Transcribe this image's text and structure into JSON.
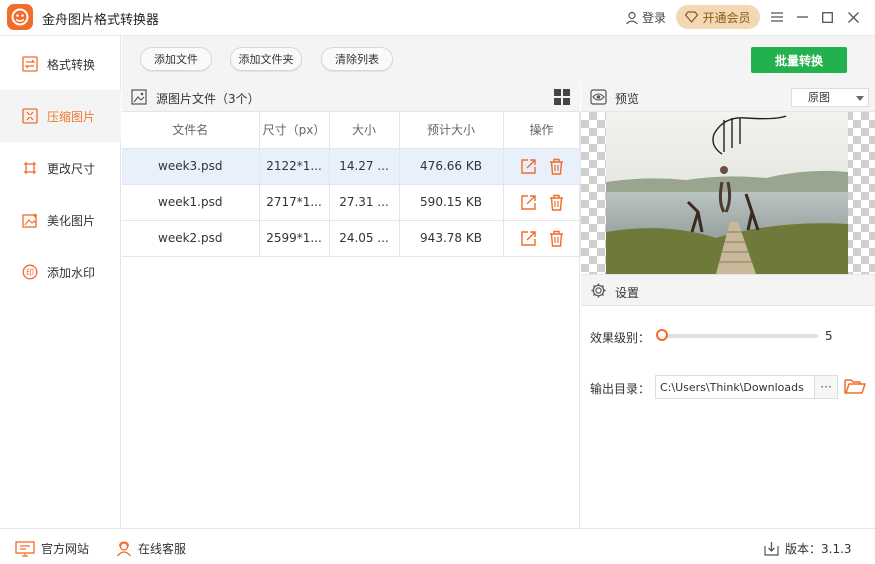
{
  "app": {
    "title": "金舟图片格式转换器"
  },
  "header": {
    "login": "登录",
    "vip": "开通会员"
  },
  "sidebar": {
    "items": [
      {
        "label": "格式转换",
        "icon": "format-convert-icon"
      },
      {
        "label": "压缩图片",
        "icon": "compress-image-icon",
        "active": true
      },
      {
        "label": "更改尺寸",
        "icon": "resize-icon"
      },
      {
        "label": "美化图片",
        "icon": "beautify-icon"
      },
      {
        "label": "添加水印",
        "icon": "watermark-icon"
      }
    ]
  },
  "toolbar": {
    "add_file": "添加文件",
    "add_folder": "添加文件夹",
    "clear_list": "清除列表",
    "batch_convert": "批量转换"
  },
  "file_panel": {
    "title": "源图片文件（3个）",
    "columns": [
      "文件名",
      "尺寸（px）",
      "大小",
      "预计大小",
      "操作"
    ],
    "rows": [
      {
        "name": "week3.psd",
        "dimensions": "2122*1...",
        "size": "14.27 ...",
        "estimated": "476.66 KB"
      },
      {
        "name": "week1.psd",
        "dimensions": "2717*1...",
        "size": "27.31 ...",
        "estimated": "590.15 KB"
      },
      {
        "name": "week2.psd",
        "dimensions": "2599*1...",
        "size": "24.05 ...",
        "estimated": "943.78 KB"
      }
    ]
  },
  "preview": {
    "label": "预览",
    "select_value": "原图"
  },
  "settings": {
    "label": "设置",
    "level_label": "效果级别：",
    "level_value": "5",
    "level_fraction": 0.0,
    "output_label": "输出目录：",
    "output_path": "C:\\Users\\Think\\Downloads",
    "more": "···"
  },
  "statusbar": {
    "website": "官方网站",
    "support": "在线客服",
    "version": "版本：3.1.3"
  },
  "colors": {
    "accent": "#f26b2b",
    "green": "#22b14c",
    "vip_bg": "#f2d9b3",
    "selected_row": "#e8f1fb"
  }
}
